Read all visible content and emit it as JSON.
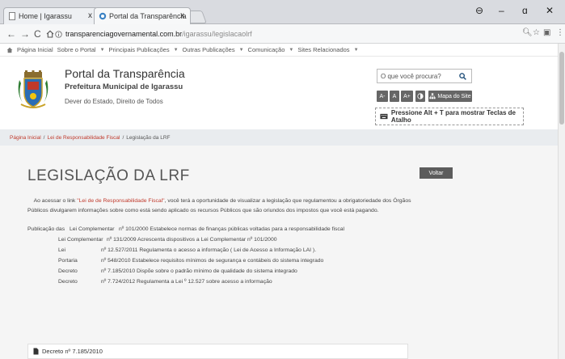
{
  "browser": {
    "tabs": [
      {
        "title": "Home | Igarassu",
        "active": false
      },
      {
        "title": "Portal da Transparência",
        "active": true
      }
    ],
    "close_glyph": "x",
    "window_controls": [
      "⊖",
      "–",
      "ɑ",
      "✕"
    ],
    "url_host": "transparenciagovernamental.com.br",
    "url_path": "/igarassu/legislacaolrf"
  },
  "sitenav": {
    "items": [
      "Página Inicial",
      "Sobre o Portal",
      "Principais Publicações",
      "Outras Publicações",
      "Comunicação",
      "Sites Relacionados"
    ]
  },
  "header": {
    "title": "Portal da Transparência",
    "subtitle": "Prefeitura Municipal de Igarassu",
    "motto": "Dever do Estado, Direito de Todos",
    "search_placeholder": "O que você procura?",
    "font_buttons": [
      "A-",
      "A",
      "A+"
    ],
    "sitemap_label": "Mapa do Site",
    "shortcut_text": "Pressione Alt + T para mostrar Teclas de Atalho"
  },
  "breadcrumb": {
    "items": [
      "Página Inicial",
      "Lei de Responsabilidade Fiscal",
      "Legislação da LRF"
    ],
    "sep": "/"
  },
  "main": {
    "title": "LEGISLAÇÃO DA LRF",
    "back_label": "Voltar",
    "intro_before": "Ao acessar o link ",
    "intro_link": "\"Lei de de Responsabilidade Fiscal\"",
    "intro_after": ", você terá a oportunidade de visualizar a legislação que regulamentou a obrigatoriedade dos Órgãos Públicos divulgarem informações sobre como está sendo aplicado os recursos Públicos que são oriundos dos impostos que você está pagando.",
    "publication_label": "Publicação das",
    "rows": [
      {
        "type": "Lei Complementar",
        "desc": "nº 101/2000 Estabelece normas de finanças públicas voltadas para a responsabilidade fiscal"
      },
      {
        "type": "Lei Complementar",
        "desc": "nº 131/2009 Acrescenta dispositivos a Lei Complementar nº 101/2000"
      },
      {
        "type": "Lei",
        "desc": "nº 12.527/2011 Regulamenta o acesso a informação ( Lei de Acesso a Informação LAI )."
      },
      {
        "type": "Portaria",
        "desc": "nº 548/2010 Estabelece requisitos mínimos de segurança e contábeis do sistema integrado"
      },
      {
        "type": "Decreto",
        "desc": "nº 7.185/2010 Dispõe sobre o padrão mínimo de qualidade do sistema integrado"
      },
      {
        "type": "Decreto",
        "desc": "nº 7.724/2012 Regulamenta a Lei º 12.527 sobre acesso a informação"
      }
    ],
    "doc_item": "Decreto nº 7.185/2010"
  }
}
